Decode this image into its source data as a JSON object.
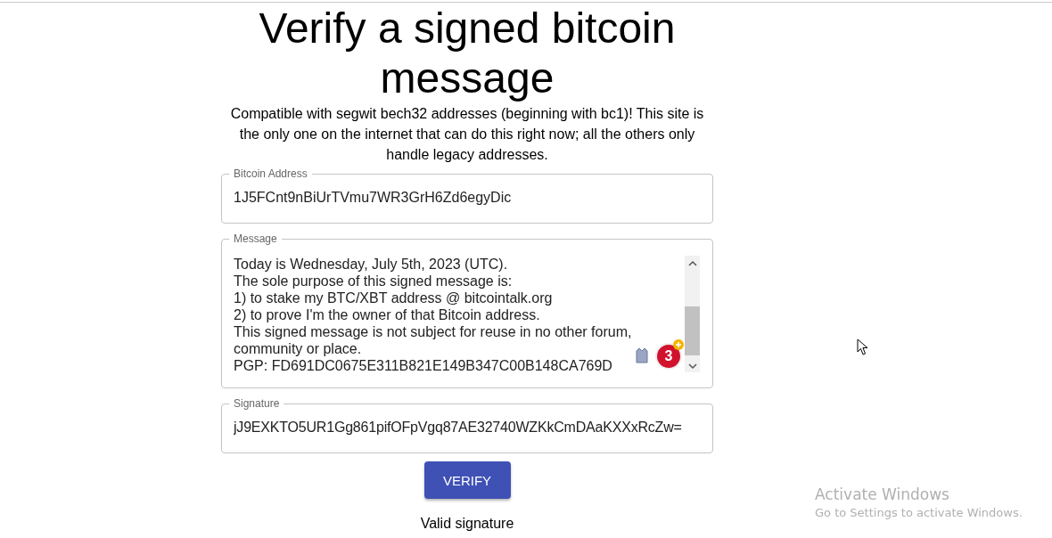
{
  "title": "Verify a signed bitcoin message",
  "intro": "Compatible with segwit bech32 addresses (beginning with bc1)! This site is the only one on the internet that can do this right now; all the others only handle legacy addresses.",
  "fields": [
    {
      "kind": "input",
      "label": "Bitcoin Address",
      "value": "1J5FCnt9nBiUrTVmu7WR3GrH6Zd6egyDic"
    },
    {
      "kind": "textarea",
      "label": "Message",
      "lines": [
        "Today is Wednesday, July 5th, 2023 (UTC).",
        "The sole purpose of this signed message is:",
        "1) to stake my BTC/XBT address @ bitcointalk.org",
        "2) to prove I'm the owner of that Bitcoin address.",
        "This signed message is not subject for reuse in no other forum,",
        "community or place.",
        "PGP: FD691DC0675E311B821E149B347C00B148CA769D"
      ],
      "badge": "3"
    },
    {
      "kind": "input",
      "label": "Signature",
      "value": "jJ9EXKTO5UR1Gg861pifOFpVgq87AE32740WZKkCmDAaKXXxRcZw="
    }
  ],
  "button": "VERIFY",
  "result": "Valid signature",
  "activation": {
    "title": "Activate Windows",
    "subtitle": "Go to Settings to activate Windows."
  }
}
